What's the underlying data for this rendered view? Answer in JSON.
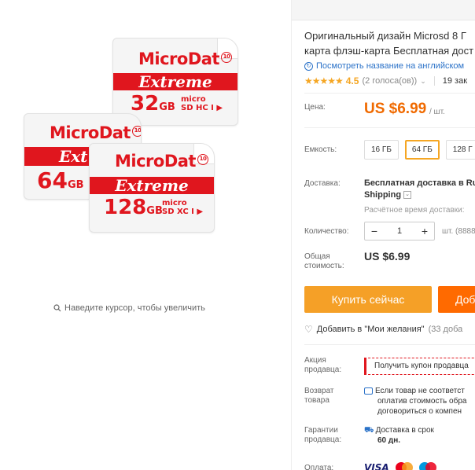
{
  "gallery": {
    "zoom_hint": "Наведите курсор, чтобы увеличить",
    "cards": [
      {
        "brand": "MicroDat",
        "badge": "10",
        "line": "Extreme",
        "capacity": "32",
        "unit": "GB",
        "logo_top": "micro",
        "logo_bottom": "SD HC I ▶"
      },
      {
        "brand": "MicroDat",
        "badge": "10",
        "line": "Ext",
        "capacity": "64",
        "unit": "GB",
        "logo_top": "",
        "logo_bottom": ""
      },
      {
        "brand": "MicroDat",
        "badge": "10",
        "line": "Extreme",
        "capacity": "128",
        "unit": "GB",
        "logo_top": "micro",
        "logo_bottom": "SD XC I ▶"
      }
    ]
  },
  "product": {
    "title_line1": "Оригинальный дизайн Microsd 8 Г",
    "title_line2": "карта флэш-карта Бесплатная дост",
    "translate_link": "Посмотреть название на английском",
    "stars": "★★★★★",
    "rating": "4.5",
    "votes": "(2 голоса(ов))",
    "orders": "19 зак"
  },
  "price": {
    "label": "Цена:",
    "value": "US $6.99",
    "unit": "/ шт."
  },
  "capacity": {
    "label": "Емкость:",
    "options": [
      "16 ГБ",
      "64 ГБ",
      "128 Г"
    ],
    "selected": "64 ГБ"
  },
  "shipping": {
    "label": "Доставка:",
    "line1": "Бесплатная доставка в Ru",
    "line2": "Shipping",
    "estimate": "Расчётное время доставки:"
  },
  "quantity": {
    "label": "Количество:",
    "minus": "−",
    "value": "1",
    "plus": "+",
    "available": "шт. (8888"
  },
  "total": {
    "label_line1": "Общая",
    "label_line2": "стоимость:",
    "value": "US $6.99"
  },
  "actions": {
    "buy": "Купить сейчас",
    "cart": "Доб",
    "wishlist": "Добавить в \"Мои желания\"",
    "wishlist_count": "(33 доба"
  },
  "seller": {
    "promo_label_1": "Акция",
    "promo_label_2": "продавца:",
    "coupon": "Получить купон продавца",
    "return_label_1": "Возврат",
    "return_label_2": "товара",
    "return_line1": "Если товар не соответст",
    "return_line2": "оплатив стоимость обра",
    "return_line3": "договориться о компен",
    "guarantee_label_1": "Гарантии",
    "guarantee_label_2": "продавца:",
    "guarantee_line1": "Доставка в срок",
    "guarantee_line2": "60 дн.",
    "payment_label": "Оплата:",
    "visa": "VISA"
  },
  "colors": {
    "accent_orange": "#f06a00",
    "buy_button": "#f5a027",
    "cart_button": "#ff6a00",
    "brand_red": "#e0161e",
    "link_blue": "#2b72c8"
  }
}
